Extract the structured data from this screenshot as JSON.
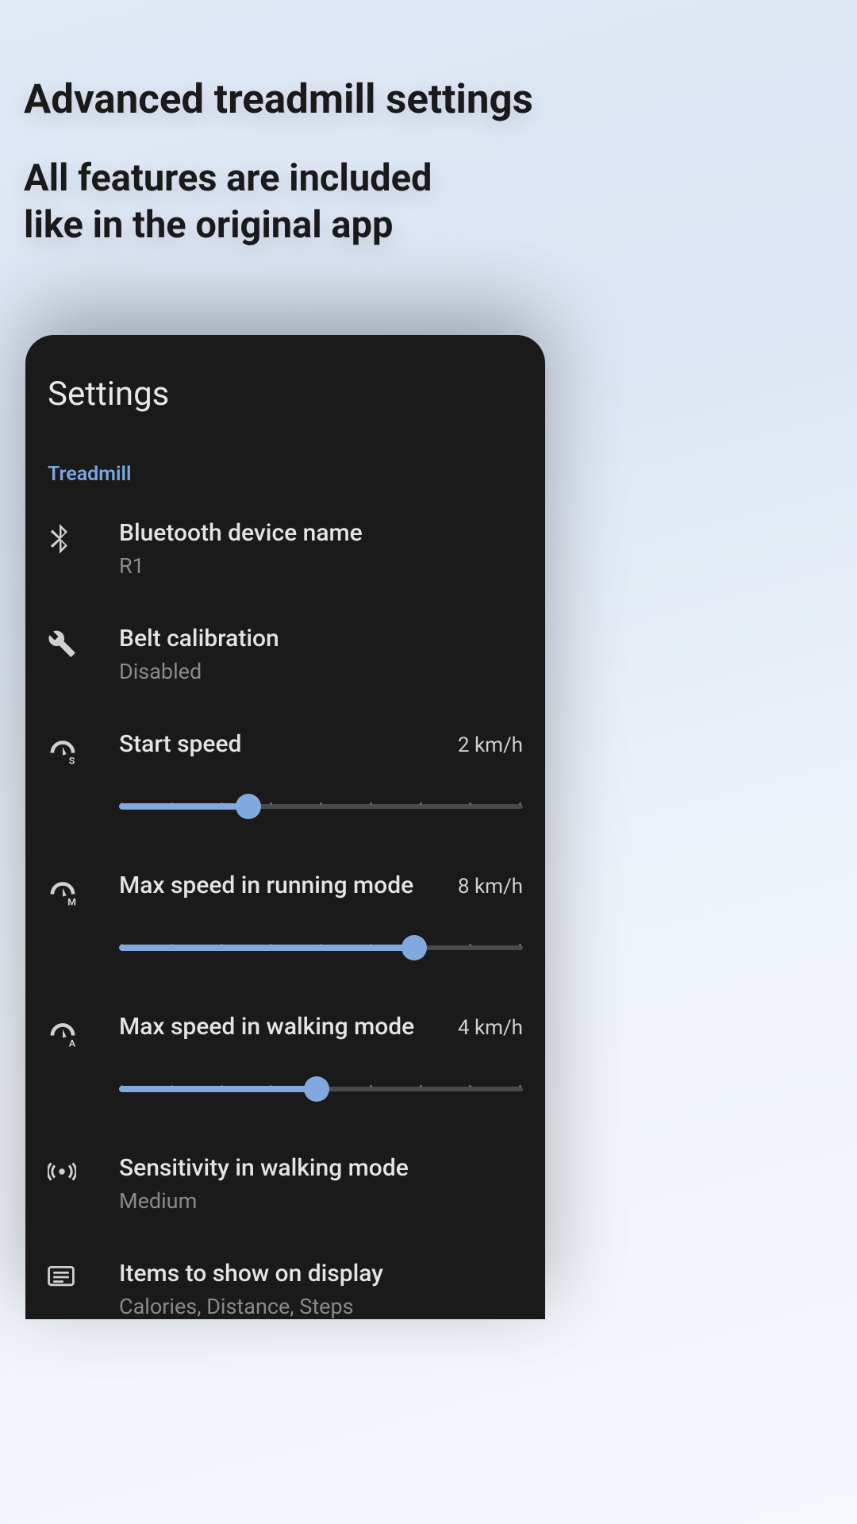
{
  "header": {
    "title": "Advanced treadmill settings",
    "subtitle_line1": "All features are included",
    "subtitle_line2": "like in the original app"
  },
  "card": {
    "title": "Settings",
    "section_label": "Treadmill",
    "bluetooth": {
      "title": "Bluetooth device name",
      "value": "R1"
    },
    "belt_calibration": {
      "title": "Belt calibration",
      "value": "Disabled"
    },
    "start_speed": {
      "title": "Start speed",
      "value": "2 km/h",
      "percent": 32
    },
    "max_speed_running": {
      "title": "Max speed in running mode",
      "value": "8 km/h",
      "percent": 73
    },
    "max_speed_walking": {
      "title": "Max speed in walking mode",
      "value": "4 km/h",
      "percent": 49
    },
    "sensitivity": {
      "title": "Sensitivity in walking mode",
      "value": "Medium"
    },
    "display_items": {
      "title": "Items to show on display",
      "value": "Calories, Distance, Steps"
    }
  }
}
